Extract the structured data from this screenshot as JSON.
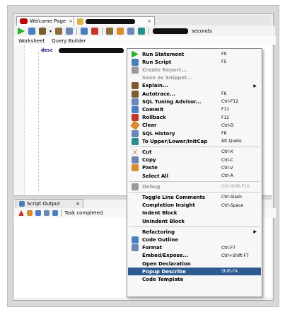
{
  "tabs": [
    {
      "label": "Welcome Page"
    },
    {
      "label": ""
    }
  ],
  "toolbar": {
    "seconds_label": "seconds"
  },
  "subtabs": [
    "Worksheet",
    "Query Builder"
  ],
  "editor": {
    "code_keyword": "desc"
  },
  "output": {
    "tab_label": "Script Output",
    "status": "Task completed"
  },
  "menu": {
    "items": [
      {
        "label": "Run Statement",
        "shortcut": "F9",
        "icon": "run-icon",
        "color": "#2bb02b"
      },
      {
        "label": "Run Script",
        "shortcut": "F5",
        "icon": "run-script-icon",
        "color": "#4a7fbf"
      },
      {
        "label": "Create Report...",
        "shortcut": "",
        "icon": "report-icon",
        "color": "#9a9a9a",
        "disabled": true
      },
      {
        "label": "Save as Snippet...",
        "shortcut": "",
        "icon": "",
        "color": "",
        "disabled": true
      },
      {
        "label": "Explain...",
        "shortcut": "",
        "icon": "explain-icon",
        "color": "#7a5c2e",
        "submenu": true
      },
      {
        "label": "Autotrace...",
        "shortcut": "F6",
        "icon": "autotrace-icon",
        "color": "#7a5c2e"
      },
      {
        "label": "SQL Tuning Advisor...",
        "shortcut": "Ctrl-F12",
        "icon": "tuning-icon",
        "color": "#6a87b5"
      },
      {
        "label": "Commit",
        "shortcut": "F11",
        "icon": "commit-icon",
        "color": "#4a7fbf"
      },
      {
        "label": "Rollback",
        "shortcut": "F12",
        "icon": "rollback-icon",
        "color": "#c0392b"
      },
      {
        "label": "Clear",
        "shortcut": "Ctrl-D",
        "icon": "eraser-icon",
        "color": "#d98c2b"
      },
      {
        "label": "SQL History",
        "shortcut": "F8",
        "icon": "history-icon",
        "color": "#6a87b5"
      },
      {
        "label": "To Upper/Lower/InitCap",
        "shortcut": "Alt-Quote",
        "icon": "case-icon",
        "color": "#2b8c8c"
      },
      {
        "label": "Cut",
        "shortcut": "Ctrl-X",
        "icon": "cut-icon",
        "color": "#c0392b"
      },
      {
        "label": "Copy",
        "shortcut": "Ctrl-C",
        "icon": "copy-icon",
        "color": "#6a87b5"
      },
      {
        "label": "Paste",
        "shortcut": "Ctrl-V",
        "icon": "paste-icon",
        "color": "#d98c2b"
      },
      {
        "label": "Select All",
        "shortcut": "Ctrl-A",
        "icon": "",
        "color": ""
      },
      {
        "label": "Debug",
        "shortcut": "Ctrl-Shift-F10",
        "icon": "debug-icon",
        "color": "#9a9a9a",
        "disabled": true
      },
      {
        "label": "Toggle Line Comments",
        "shortcut": "Ctrl-Slash",
        "icon": "",
        "color": ""
      },
      {
        "label": "Completion Insight",
        "shortcut": "Ctrl-Space",
        "icon": "",
        "color": ""
      },
      {
        "label": "Indent Block",
        "shortcut": "",
        "icon": "",
        "color": ""
      },
      {
        "label": "Unindent Block",
        "shortcut": "",
        "icon": "",
        "color": ""
      },
      {
        "label": "Refactoring",
        "shortcut": "",
        "icon": "",
        "color": "",
        "submenu": true
      },
      {
        "label": "Code Outline",
        "shortcut": "",
        "icon": "outline-icon",
        "color": "#4a7fbf"
      },
      {
        "label": "Format",
        "shortcut": "Ctrl-F7",
        "icon": "format-icon",
        "color": "#6a87b5"
      },
      {
        "label": "Embed/Expose...",
        "shortcut": "Ctrl+Shift-F7",
        "icon": "",
        "color": ""
      },
      {
        "label": "Open Declaration",
        "shortcut": "",
        "icon": "",
        "color": ""
      },
      {
        "label": "Popup Describe",
        "shortcut": "Shift-F4",
        "icon": "",
        "color": "",
        "selected": true
      },
      {
        "label": "Code Template",
        "shortcut": "",
        "icon": "",
        "color": ""
      }
    ]
  }
}
